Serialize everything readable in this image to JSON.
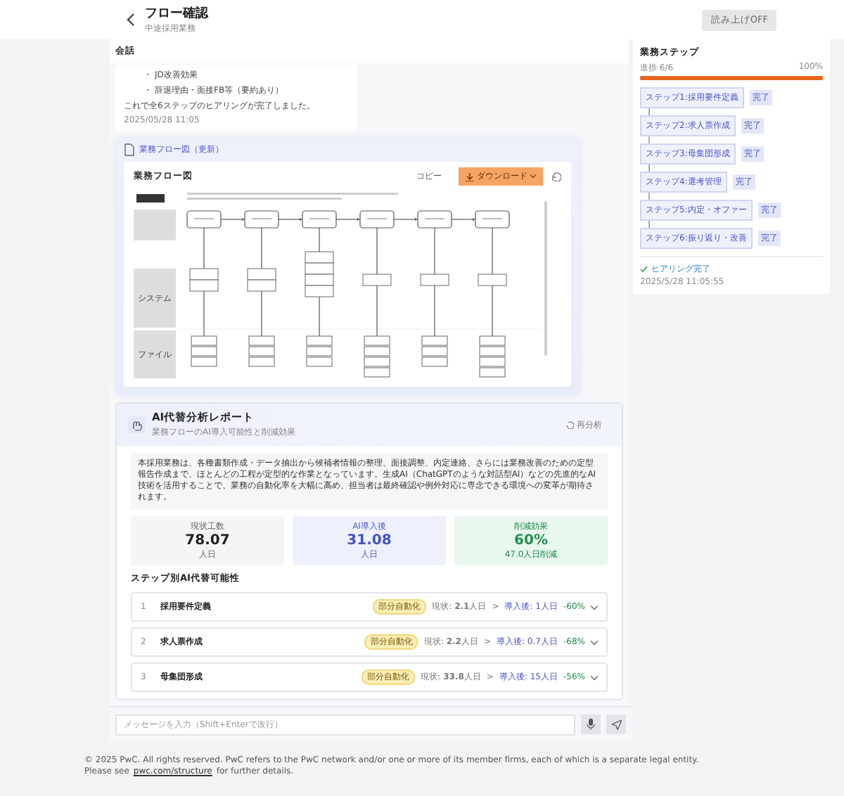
{
  "header": {
    "title": "フロー確認",
    "subtitle": "中途採用業務",
    "read_aloud_button": "読み上げOFF"
  },
  "conversation": {
    "heading": "会話",
    "message": {
      "bullet_marker": "・",
      "bullets": [
        "JD改善効果",
        "辞退理由・面接FB等（要約あり）"
      ],
      "text": "これで全6ステップのヒアリングが完了しました。",
      "time": "2025/05/28 11:05"
    }
  },
  "flow_card": {
    "title": "業務フロー図（更新）",
    "diagram_title": "業務フロー図",
    "copy_button": "コピー",
    "download_button": "ダウンロード",
    "lanes": [
      "システム",
      "ファイル"
    ]
  },
  "report": {
    "title": "AI代替分析レポート",
    "subtitle": "業務フローのAI導入可能性と削減効果",
    "reanalyze_button": "再分析",
    "summary": "本採用業務は、各種書類作成・データ抽出から候補者情報の整理、面接調整、内定連絡、さらには業務改善のための定型報告作成まで、ほとんどの工程が定型的な作業となっています。生成AI（ChatGPTのような対話型AI）などの先進的なAI技術を活用することで、業務の自動化率を大幅に高め、担当者は最終確認や例外対応に専念できる環境への変革が期待されます。",
    "stats": [
      {
        "kind": "current",
        "label": "現状工数",
        "value": "78.07",
        "unit": "人日"
      },
      {
        "kind": "after",
        "label": "AI導入後",
        "value": "31.08",
        "unit": "人日"
      },
      {
        "kind": "saving",
        "label": "削減効果",
        "value": "60%",
        "unit": "47.0人日削減"
      }
    ],
    "steps_heading": "ステップ別AI代替可能性",
    "rows": [
      {
        "no": "1",
        "name": "採用要件定義",
        "tag": "部分自動化",
        "before": "現状: **2.1**人日",
        "arrow": ">",
        "after": "導入後: 1人日",
        "reduction": "-60%",
        "expanded": false
      },
      {
        "no": "2",
        "name": "求人票作成",
        "tag": "部分自動化",
        "before": "現状: **2.2**人日",
        "arrow": ">",
        "after": "導入後: 0.7人日",
        "reduction": "-68%",
        "expanded": false
      },
      {
        "no": "3",
        "name": "母集団形成",
        "tag": "部分自動化",
        "before": "現状: **33.8**人日",
        "arrow": ">",
        "after": "導入後: 15人日",
        "reduction": "-56%",
        "expanded": false
      }
    ]
  },
  "steps_panel": {
    "heading": "業務ステップ",
    "progress_label": "進捗 6/6",
    "progress_percent": "100%",
    "level": 1,
    "steps": [
      {
        "label": "ステップ1:採用要件定義",
        "status": "完了"
      },
      {
        "label": "ステップ2:求人票作成",
        "status": "完了"
      },
      {
        "label": "ステップ3:母集団形成",
        "status": "完了"
      },
      {
        "label": "ステップ4:選考管理",
        "status": "完了"
      },
      {
        "label": "ステップ5:内定・オファー",
        "status": "完了"
      },
      {
        "label": "ステップ6:振り返り・改善",
        "status": "完了"
      }
    ],
    "completion": {
      "label": "ヒアリング完了",
      "time": "2025/5/28 11:05:55"
    }
  },
  "input": {
    "placeholder": "メッセージを入力（Shift+Enterで改行）"
  },
  "footer": {
    "line1": "© 2025 PwC. All rights reserved. PwC refers to the PwC network and/or one or more of its member firms, each of which is a separate legal entity.",
    "line2_before": "Please see",
    "link": "pwc.com/structure",
    "line2_after": "for further details."
  }
}
